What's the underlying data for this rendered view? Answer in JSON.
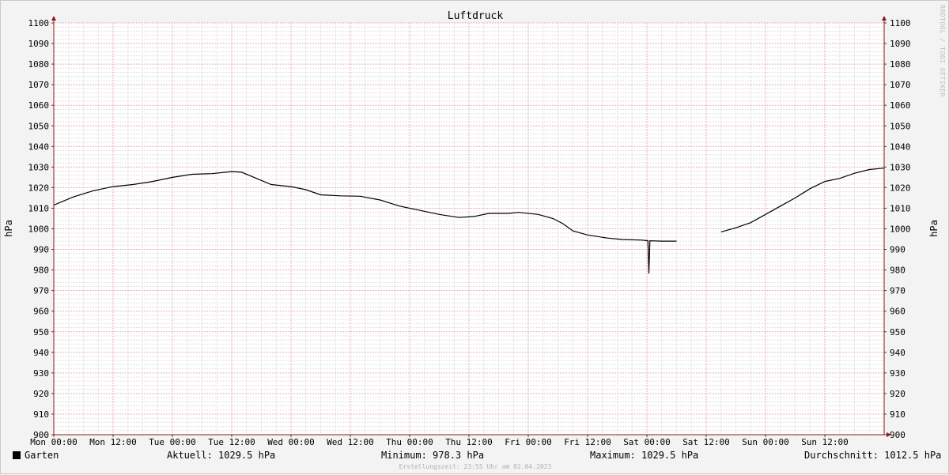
{
  "chart_data": {
    "type": "line",
    "title": "Luftdruck",
    "ylabel": "hPa",
    "ylim": [
      900,
      1100
    ],
    "yticks": [
      900,
      910,
      920,
      930,
      940,
      950,
      960,
      970,
      980,
      990,
      1000,
      1010,
      1020,
      1030,
      1040,
      1050,
      1060,
      1070,
      1080,
      1090,
      1100
    ],
    "xlim": [
      0,
      168
    ],
    "xticks": [
      {
        "h": 0,
        "label": "Mon 00:00"
      },
      {
        "h": 12,
        "label": "Mon 12:00"
      },
      {
        "h": 24,
        "label": "Tue 00:00"
      },
      {
        "h": 36,
        "label": "Tue 12:00"
      },
      {
        "h": 48,
        "label": "Wed 00:00"
      },
      {
        "h": 60,
        "label": "Wed 12:00"
      },
      {
        "h": 72,
        "label": "Thu 00:00"
      },
      {
        "h": 84,
        "label": "Thu 12:00"
      },
      {
        "h": 96,
        "label": "Fri 00:00"
      },
      {
        "h": 108,
        "label": "Fri 12:00"
      },
      {
        "h": 120,
        "label": "Sat 00:00"
      },
      {
        "h": 132,
        "label": "Sat 12:00"
      },
      {
        "h": 144,
        "label": "Sun 00:00"
      },
      {
        "h": 156,
        "label": "Sun 12:00"
      }
    ],
    "grid": true,
    "legend_placement": "bottom-left",
    "series": [
      {
        "name": "Garten",
        "color": "#000000",
        "segments": [
          [
            [
              0,
              1011.5
            ],
            [
              4,
              1015.5
            ],
            [
              8,
              1018.5
            ],
            [
              12,
              1020.5
            ],
            [
              16,
              1021.5
            ],
            [
              20,
              1023
            ],
            [
              24,
              1025
            ],
            [
              28,
              1026.5
            ],
            [
              32,
              1026.8
            ],
            [
              36,
              1027.8
            ],
            [
              38,
              1027.5
            ],
            [
              40,
              1025.5
            ],
            [
              42,
              1023.5
            ],
            [
              44,
              1021.5
            ],
            [
              48,
              1020.5
            ],
            [
              51,
              1019
            ],
            [
              54,
              1016.5
            ],
            [
              58,
              1016
            ],
            [
              62,
              1015.8
            ],
            [
              66,
              1014
            ],
            [
              70,
              1011
            ],
            [
              74,
              1009
            ],
            [
              78,
              1007
            ],
            [
              82,
              1005.5
            ],
            [
              85,
              1006
            ],
            [
              88,
              1007.5
            ],
            [
              92,
              1007.5
            ],
            [
              94,
              1008
            ],
            [
              98,
              1007
            ],
            [
              101,
              1005
            ],
            [
              103,
              1002.5
            ],
            [
              105,
              999
            ],
            [
              108,
              997
            ],
            [
              112,
              995.5
            ],
            [
              115,
              994.8
            ],
            [
              119,
              994.5
            ],
            [
              120.2,
              994.2
            ],
            [
              120.4,
              978.3
            ],
            [
              120.6,
              994.2
            ],
            [
              123,
              994
            ],
            [
              126,
              994
            ]
          ],
          [
            [
              135,
              998.5
            ],
            [
              138,
              1000.5
            ],
            [
              141,
              1003
            ],
            [
              144,
              1007
            ],
            [
              147,
              1011
            ],
            [
              150,
              1015
            ],
            [
              153,
              1019.5
            ],
            [
              156,
              1023
            ],
            [
              159,
              1024.5
            ],
            [
              162,
              1027
            ],
            [
              165,
              1028.8
            ],
            [
              168,
              1029.5
            ]
          ]
        ]
      }
    ],
    "stats": {
      "current": "Aktuell: 1029.5 hPa",
      "min": "Minimum: 978.3 hPa",
      "max": "Maximum: 1029.5 hPa",
      "avg": "Durchschnitt: 1012.5 hPa"
    }
  },
  "watermark": "RRDTOOL / TOBI OETIKER",
  "footer": "Erstellungszeit: 23:55 Uhr am 02.04.2023",
  "colors": {
    "background": "#f3f3f3",
    "plot_bg": "#ffffff",
    "minor_grid": "#dcdcdc",
    "major_grid": "#e8a0a0",
    "axis": "#8b1a1a"
  }
}
